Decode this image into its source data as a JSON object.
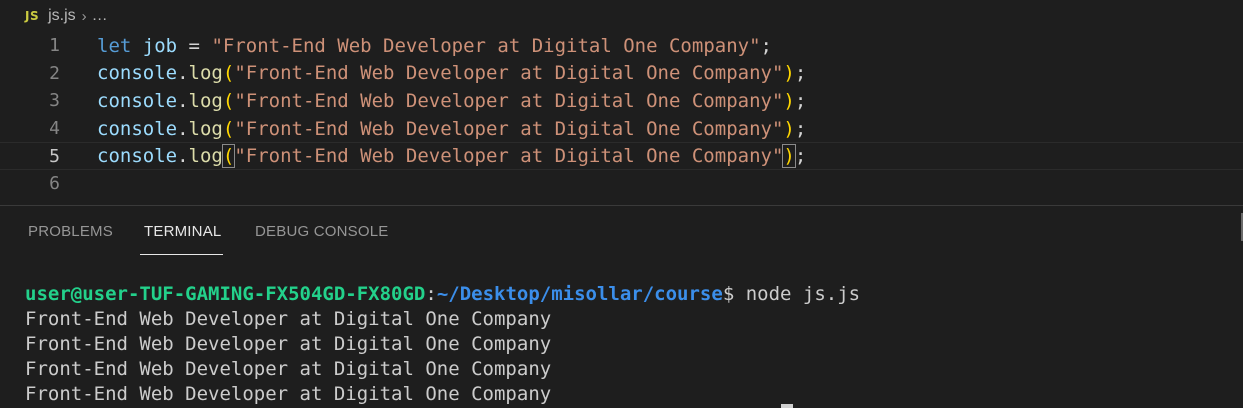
{
  "breadcrumb": {
    "file_icon_label": "JS",
    "file_name": "js.js",
    "separator": "›",
    "ellipsis": "…"
  },
  "editor": {
    "lines": [
      {
        "number": "1",
        "keyword": "let",
        "variable": "job",
        "operator": " = ",
        "string": "\"Front-End Web Developer at Digital One Company\"",
        "end": ";"
      },
      {
        "number": "2",
        "object": "console",
        "dot": ".",
        "method": "log",
        "open": "(",
        "string": "\"Front-End Web Developer at Digital One Company\"",
        "close": ")",
        "end": ";"
      },
      {
        "number": "3",
        "object": "console",
        "dot": ".",
        "method": "log",
        "open": "(",
        "string": "\"Front-End Web Developer at Digital One Company\"",
        "close": ")",
        "end": ";"
      },
      {
        "number": "4",
        "object": "console",
        "dot": ".",
        "method": "log",
        "open": "(",
        "string": "\"Front-End Web Developer at Digital One Company\"",
        "close": ")",
        "end": ";"
      },
      {
        "number": "5",
        "object": "console",
        "dot": ".",
        "method": "log",
        "open": "(",
        "string": "\"Front-End Web Developer at Digital One Company\"",
        "close": ")",
        "end": ";"
      },
      {
        "number": "6"
      }
    ]
  },
  "panel": {
    "tabs": [
      {
        "label": "PROBLEMS",
        "active": false
      },
      {
        "label": "TERMINAL",
        "active": true
      },
      {
        "label": "DEBUG CONSOLE",
        "active": false
      }
    ]
  },
  "terminal": {
    "prompt_user": "user@user-TUF-GAMING-FX504GD-FX80GD",
    "prompt_colon": ":",
    "prompt_path": "~/Desktop/misollar/course",
    "prompt_symbol": "$ ",
    "command": "node js.js",
    "output": [
      "Front-End Web Developer at Digital One Company",
      "Front-End Web Developer at Digital One Company",
      "Front-End Web Developer at Digital One Company",
      "Front-End Web Developer at Digital One Company"
    ]
  },
  "colors": {
    "background": "#1e1e1e",
    "keyword": "#569cd6",
    "variable": "#9cdcfe",
    "string": "#ce9178",
    "function": "#dcdcaa",
    "bracket": "#ffd700",
    "prompt_user": "#23d18b",
    "prompt_path": "#3b8eea"
  }
}
